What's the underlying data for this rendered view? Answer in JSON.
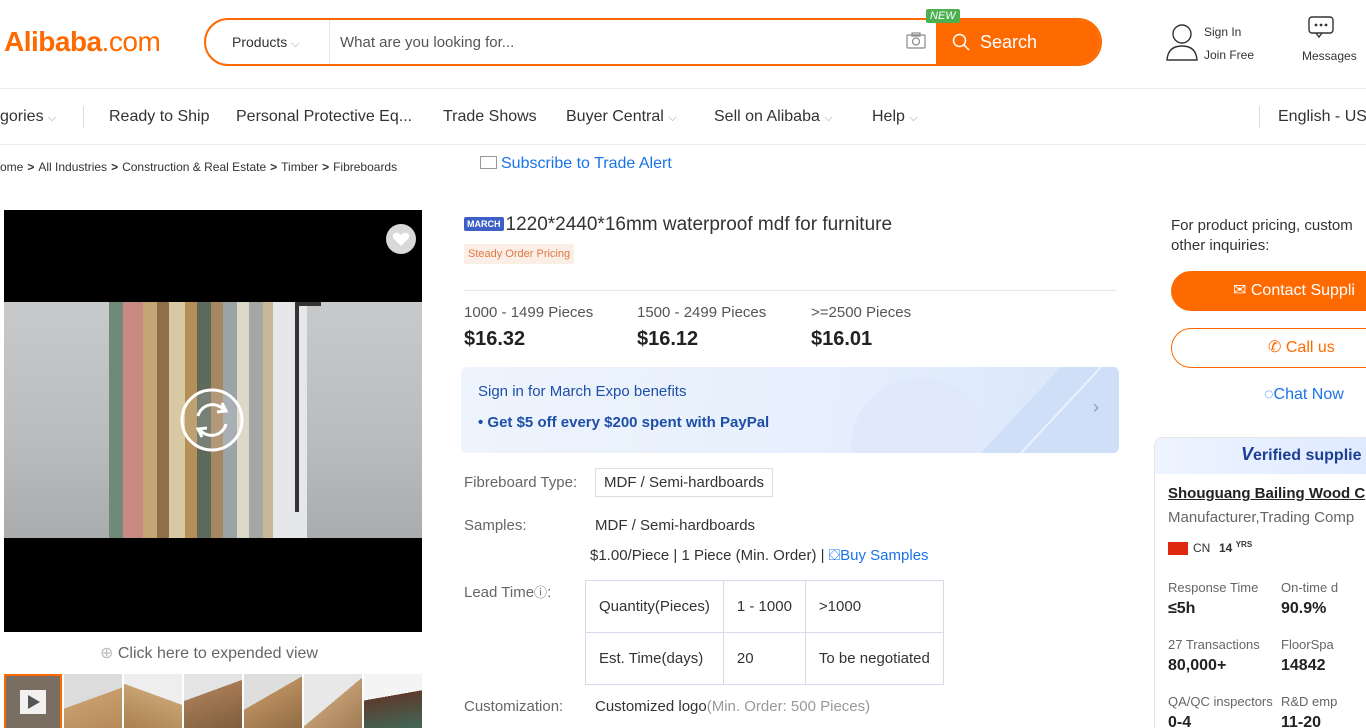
{
  "header": {
    "logo_brand": "Alibaba",
    "logo_domain": ".com",
    "search_category": "Products",
    "search_placeholder": "What are you looking for...",
    "new_badge": "NEW",
    "search_button": "Search",
    "sign_in": "Sign In",
    "join_free": "Join Free",
    "messages": "Messages"
  },
  "nav": {
    "categories": "gories",
    "ready_to_ship": "Ready to Ship",
    "ppe": "Personal Protective Eq...",
    "trade_shows": "Trade Shows",
    "buyer_central": "Buyer Central",
    "sell": "Sell on Alibaba",
    "help": "Help",
    "language": "English - USI"
  },
  "breadcrumb": {
    "items": [
      "ome",
      "All Industries",
      "Construction & Real Estate",
      "Timber",
      "Fibreboards"
    ],
    "subscribe": "Subscribe to Trade Alert"
  },
  "gallery": {
    "expand_label": "Click here to expended view"
  },
  "product": {
    "badge": "MARCH",
    "title": "1220*2440*16mm waterproof mdf for furniture",
    "steady_label": "Steady Order Pricing",
    "tiers": [
      {
        "qty": "1000 - 1499 Pieces",
        "price": "$16.32"
      },
      {
        "qty": "1500 - 2499 Pieces",
        "price": "$16.12"
      },
      {
        "qty": ">=2500 Pieces",
        "price": "$16.01"
      }
    ],
    "promo_line1": "Sign in for March Expo benefits",
    "promo_line2": "• Get $5 off every $200 spent with PayPal",
    "fibreboard_label": "Fibreboard Type:",
    "fibreboard_value": "MDF / Semi-hardboards",
    "samples_label": "Samples:",
    "samples_value": "MDF / Semi-hardboards",
    "samples_price": "$1.00/Piece | 1 Piece (Min. Order) | ",
    "buy_samples": "Buy Samples",
    "lead_label": "Lead Time",
    "lead_table": {
      "row1": [
        "Quantity(Pieces)",
        "1 - 1000",
        ">1000"
      ],
      "row2": [
        "Est. Time(days)",
        "20",
        "To be negotiated"
      ]
    },
    "custom_label": "Customization:",
    "custom_value": "Customized logo",
    "custom_min": "(Min. Order: 500 Pieces)"
  },
  "supplier": {
    "inquiry_text": "For product pricing, custom other inquiries:",
    "contact_btn": "Contact Suppli",
    "call_btn": "Call us",
    "chat_now": "Chat Now",
    "verified_v": "V",
    "verified_rest": "erified supplie",
    "name": "Shouguang Bailing Wood C",
    "type": "Manufacturer,Trading Comp",
    "country": "CN",
    "years": "14",
    "years_unit": "YRS",
    "stats": [
      {
        "label": "Response Time",
        "value": "≤5h"
      },
      {
        "label": "On-time d",
        "value": "90.9%"
      },
      {
        "label": "27 Transactions",
        "value": "80,000+"
      },
      {
        "label": "FloorSpa",
        "value": "14842"
      },
      {
        "label": "QA/QC inspectors",
        "value": "0-4"
      },
      {
        "label": "R&D emp",
        "value": "11-20"
      }
    ]
  },
  "colors": {
    "brand_orange": "#ff6a00",
    "link_blue": "#1a73e8",
    "march_blue": "#3e5fc6"
  }
}
